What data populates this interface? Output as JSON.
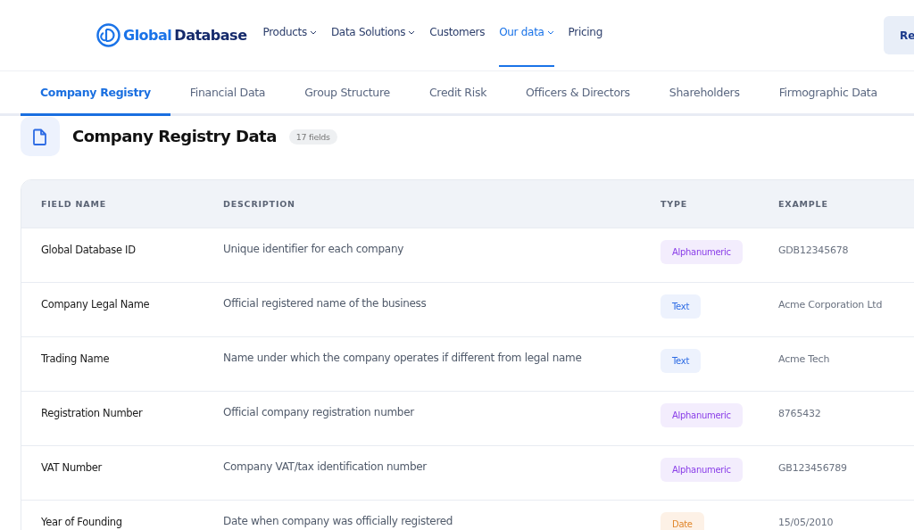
{
  "header": {
    "logo": {
      "first": "Global",
      "second": "Database"
    },
    "nav": [
      {
        "label": "Products",
        "dropdown": true,
        "selected": false
      },
      {
        "label": "Data Solutions",
        "dropdown": true,
        "selected": false
      },
      {
        "label": "Customers",
        "dropdown": false,
        "selected": false
      },
      {
        "label": "Our data",
        "dropdown": true,
        "selected": true
      },
      {
        "label": "Pricing",
        "dropdown": false,
        "selected": false
      }
    ],
    "cta": "Re"
  },
  "tabs": [
    {
      "label": "Company Registry",
      "selected": true
    },
    {
      "label": "Financial Data",
      "selected": false
    },
    {
      "label": "Group Structure",
      "selected": false
    },
    {
      "label": "Credit Risk",
      "selected": false
    },
    {
      "label": "Officers & Directors",
      "selected": false
    },
    {
      "label": "Shareholders",
      "selected": false
    },
    {
      "label": "Firmographic Data",
      "selected": false
    }
  ],
  "section": {
    "title": "Company Registry Data",
    "count": "17 fields"
  },
  "table": {
    "columns": [
      "FIELD NAME",
      "DESCRIPTION",
      "TYPE",
      "EXAMPLE"
    ],
    "rows": [
      {
        "name": "Global Database ID",
        "description": "Unique identifier for each company",
        "type": {
          "label": "Alphanumeric",
          "kind": "alphanumeric"
        },
        "example": "GDB12345678"
      },
      {
        "name": "Company Legal Name",
        "description": "Official registered name of the business",
        "type": {
          "label": "Text",
          "kind": "text"
        },
        "example": "Acme Corporation Ltd"
      },
      {
        "name": "Trading Name",
        "description": "Name under which the company operates if different from legal name",
        "type": {
          "label": "Text",
          "kind": "text"
        },
        "example": "Acme Tech"
      },
      {
        "name": "Registration Number",
        "description": "Official company registration number",
        "type": {
          "label": "Alphanumeric",
          "kind": "alphanumeric"
        },
        "example": "8765432"
      },
      {
        "name": "VAT Number",
        "description": "Company VAT/tax identification number",
        "type": {
          "label": "Alphanumeric",
          "kind": "alphanumeric"
        },
        "example": "GB123456789"
      },
      {
        "name": "Year of Founding",
        "description": "Date when company was officially registered",
        "type": {
          "label": "Date",
          "kind": "date"
        },
        "example": "15/05/2010"
      }
    ]
  }
}
